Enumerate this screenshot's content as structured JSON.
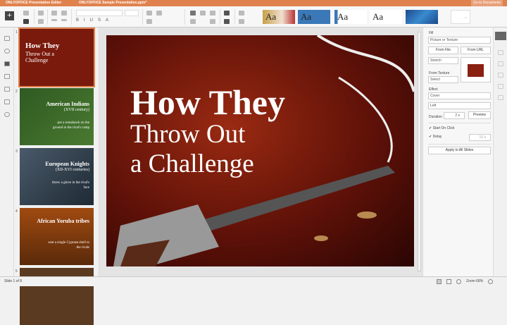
{
  "titlebar": {
    "app": "ONLYOFFICE Presentation Editor",
    "file": "ONLYOFFICE Sample Presentation.pptx*",
    "go_to": "Go to Documents"
  },
  "toolbar": {
    "themes": [
      "Aa",
      "Aa",
      "Aa",
      "Aa",
      ""
    ]
  },
  "thumbnails": [
    {
      "num": "1",
      "title": "How They",
      "sub": "Throw Out a Challenge",
      "body": "",
      "bg": "#7a1a0c"
    },
    {
      "num": "2",
      "title": "American Indians",
      "sub": "(XVII century)",
      "body": "put a tomahawk on the ground in the rival's camp",
      "bg": "#2f5a22"
    },
    {
      "num": "3",
      "title": "European Knights",
      "sub": "(XII-XVI centuries)",
      "body": "threw a glove in the rival's face",
      "bg": "#2d3c4a"
    },
    {
      "num": "4",
      "title": "African Yoruba tribes",
      "sub": "",
      "body": "sent a single Cypraea shell to the rivals",
      "bg": "#7a3a0c"
    },
    {
      "num": "5",
      "title": "",
      "sub": "",
      "body": "",
      "bg": "#5a3a20"
    }
  ],
  "slide": {
    "title": "How They",
    "line2": "Throw Out",
    "line3": "a Challenge"
  },
  "panel": {
    "fill_label": "Fill",
    "fill_value": "Picture or Texture",
    "from_file": "From File",
    "from_url": "From URL",
    "stretch": "Stretch",
    "from_texture_label": "From Texture",
    "texture_select": "Select",
    "effect_label": "Effect",
    "effect_value": "Cover",
    "direction": "Left",
    "duration_label": "Duration",
    "duration_value": "2 s",
    "preview": "Preview",
    "start_on_click": "Start On Click",
    "delay_label": "Delay",
    "delay_value": "10 s",
    "apply_all": "Apply to All Slides"
  },
  "status": {
    "slide_of": "Slide 1 of 8",
    "zoom": "Zoom 68%"
  },
  "colors": {
    "accent": "#e0824e"
  }
}
